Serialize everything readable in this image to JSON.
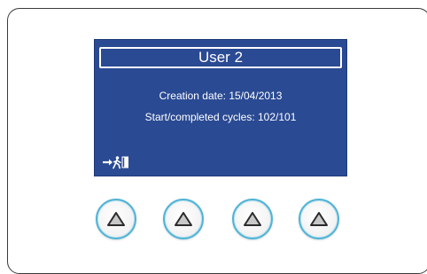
{
  "screen": {
    "title": "User 2",
    "creation_date_text": "Creation date: 15/04/2013",
    "cycles_text": "Start/completed cycles: 102/101",
    "exit_icon": "exit-icon"
  },
  "buttons": [
    {
      "icon": "up-triangle-icon"
    },
    {
      "icon": "up-triangle-icon"
    },
    {
      "icon": "up-triangle-icon"
    },
    {
      "icon": "up-triangle-icon"
    }
  ],
  "colors": {
    "screen_background": "#2a4a93",
    "text": "#ffffff",
    "button_ring": "#4fb3d6",
    "triangle_fill": "#c8c8c8"
  }
}
